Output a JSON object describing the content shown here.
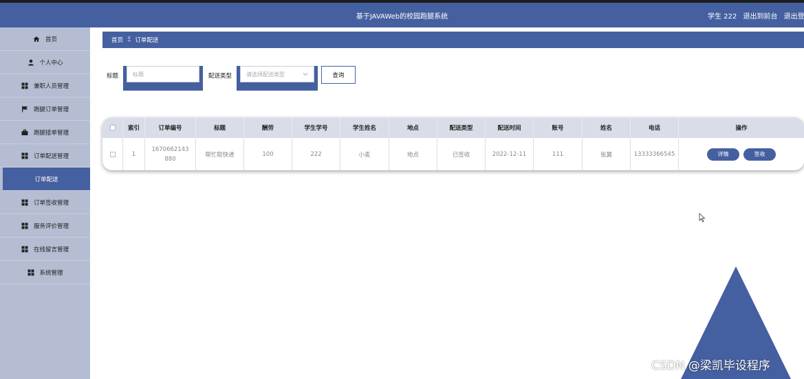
{
  "header": {
    "title": "基于JAVAWeb的校园跑腿系统",
    "user": "学生 222",
    "to_front": "退出到前台",
    "logout": "退出登录"
  },
  "sidebar": {
    "items": [
      {
        "label": "首页",
        "icon": "home-icon"
      },
      {
        "label": "个人中心",
        "icon": "user-icon"
      },
      {
        "label": "兼职人员管理",
        "icon": "grid-icon"
      },
      {
        "label": "跑腿订单管理",
        "icon": "flag-icon"
      },
      {
        "label": "跑腿接单管理",
        "icon": "briefcase-icon"
      },
      {
        "label": "订单配送管理",
        "icon": "grid-icon"
      },
      {
        "label": "订单配送",
        "icon": ""
      },
      {
        "label": "订单签收管理",
        "icon": "grid-icon"
      },
      {
        "label": "服务评价管理",
        "icon": "grid-icon"
      },
      {
        "label": "在线留言管理",
        "icon": "grid-icon"
      },
      {
        "label": "系统管理",
        "icon": "grid-icon"
      }
    ]
  },
  "breadcrumb": {
    "home": "首页",
    "sep": "Ξ",
    "current": "订单配送"
  },
  "search": {
    "title_label": "标题",
    "title_placeholder": "标题",
    "type_label": "配送类型",
    "type_placeholder": "请选择配送类型",
    "query_button": "查询"
  },
  "table": {
    "columns": [
      "索引",
      "订单编号",
      "标题",
      "酬劳",
      "学生学号",
      "学生姓名",
      "地点",
      "配送类型",
      "配送时间",
      "账号",
      "姓名",
      "电话",
      "操作"
    ],
    "rows": [
      {
        "index": "1",
        "order_no": "1670662143880",
        "title": "帮忙取快递",
        "reward": "100",
        "student_id": "222",
        "student_name": "小麦",
        "location": "地点",
        "delivery_type": "已签收",
        "delivery_time": "2022-12-11",
        "account": "111",
        "name": "张翼",
        "phone": "13333366545",
        "actions": [
          "详情",
          "签收"
        ]
      }
    ]
  },
  "watermark": "CSDN @梁凯毕设程序",
  "colors": {
    "primary": "#4560a0",
    "sidebar_bg": "#b4bdd2",
    "table_head_bg": "#d8dde8"
  }
}
